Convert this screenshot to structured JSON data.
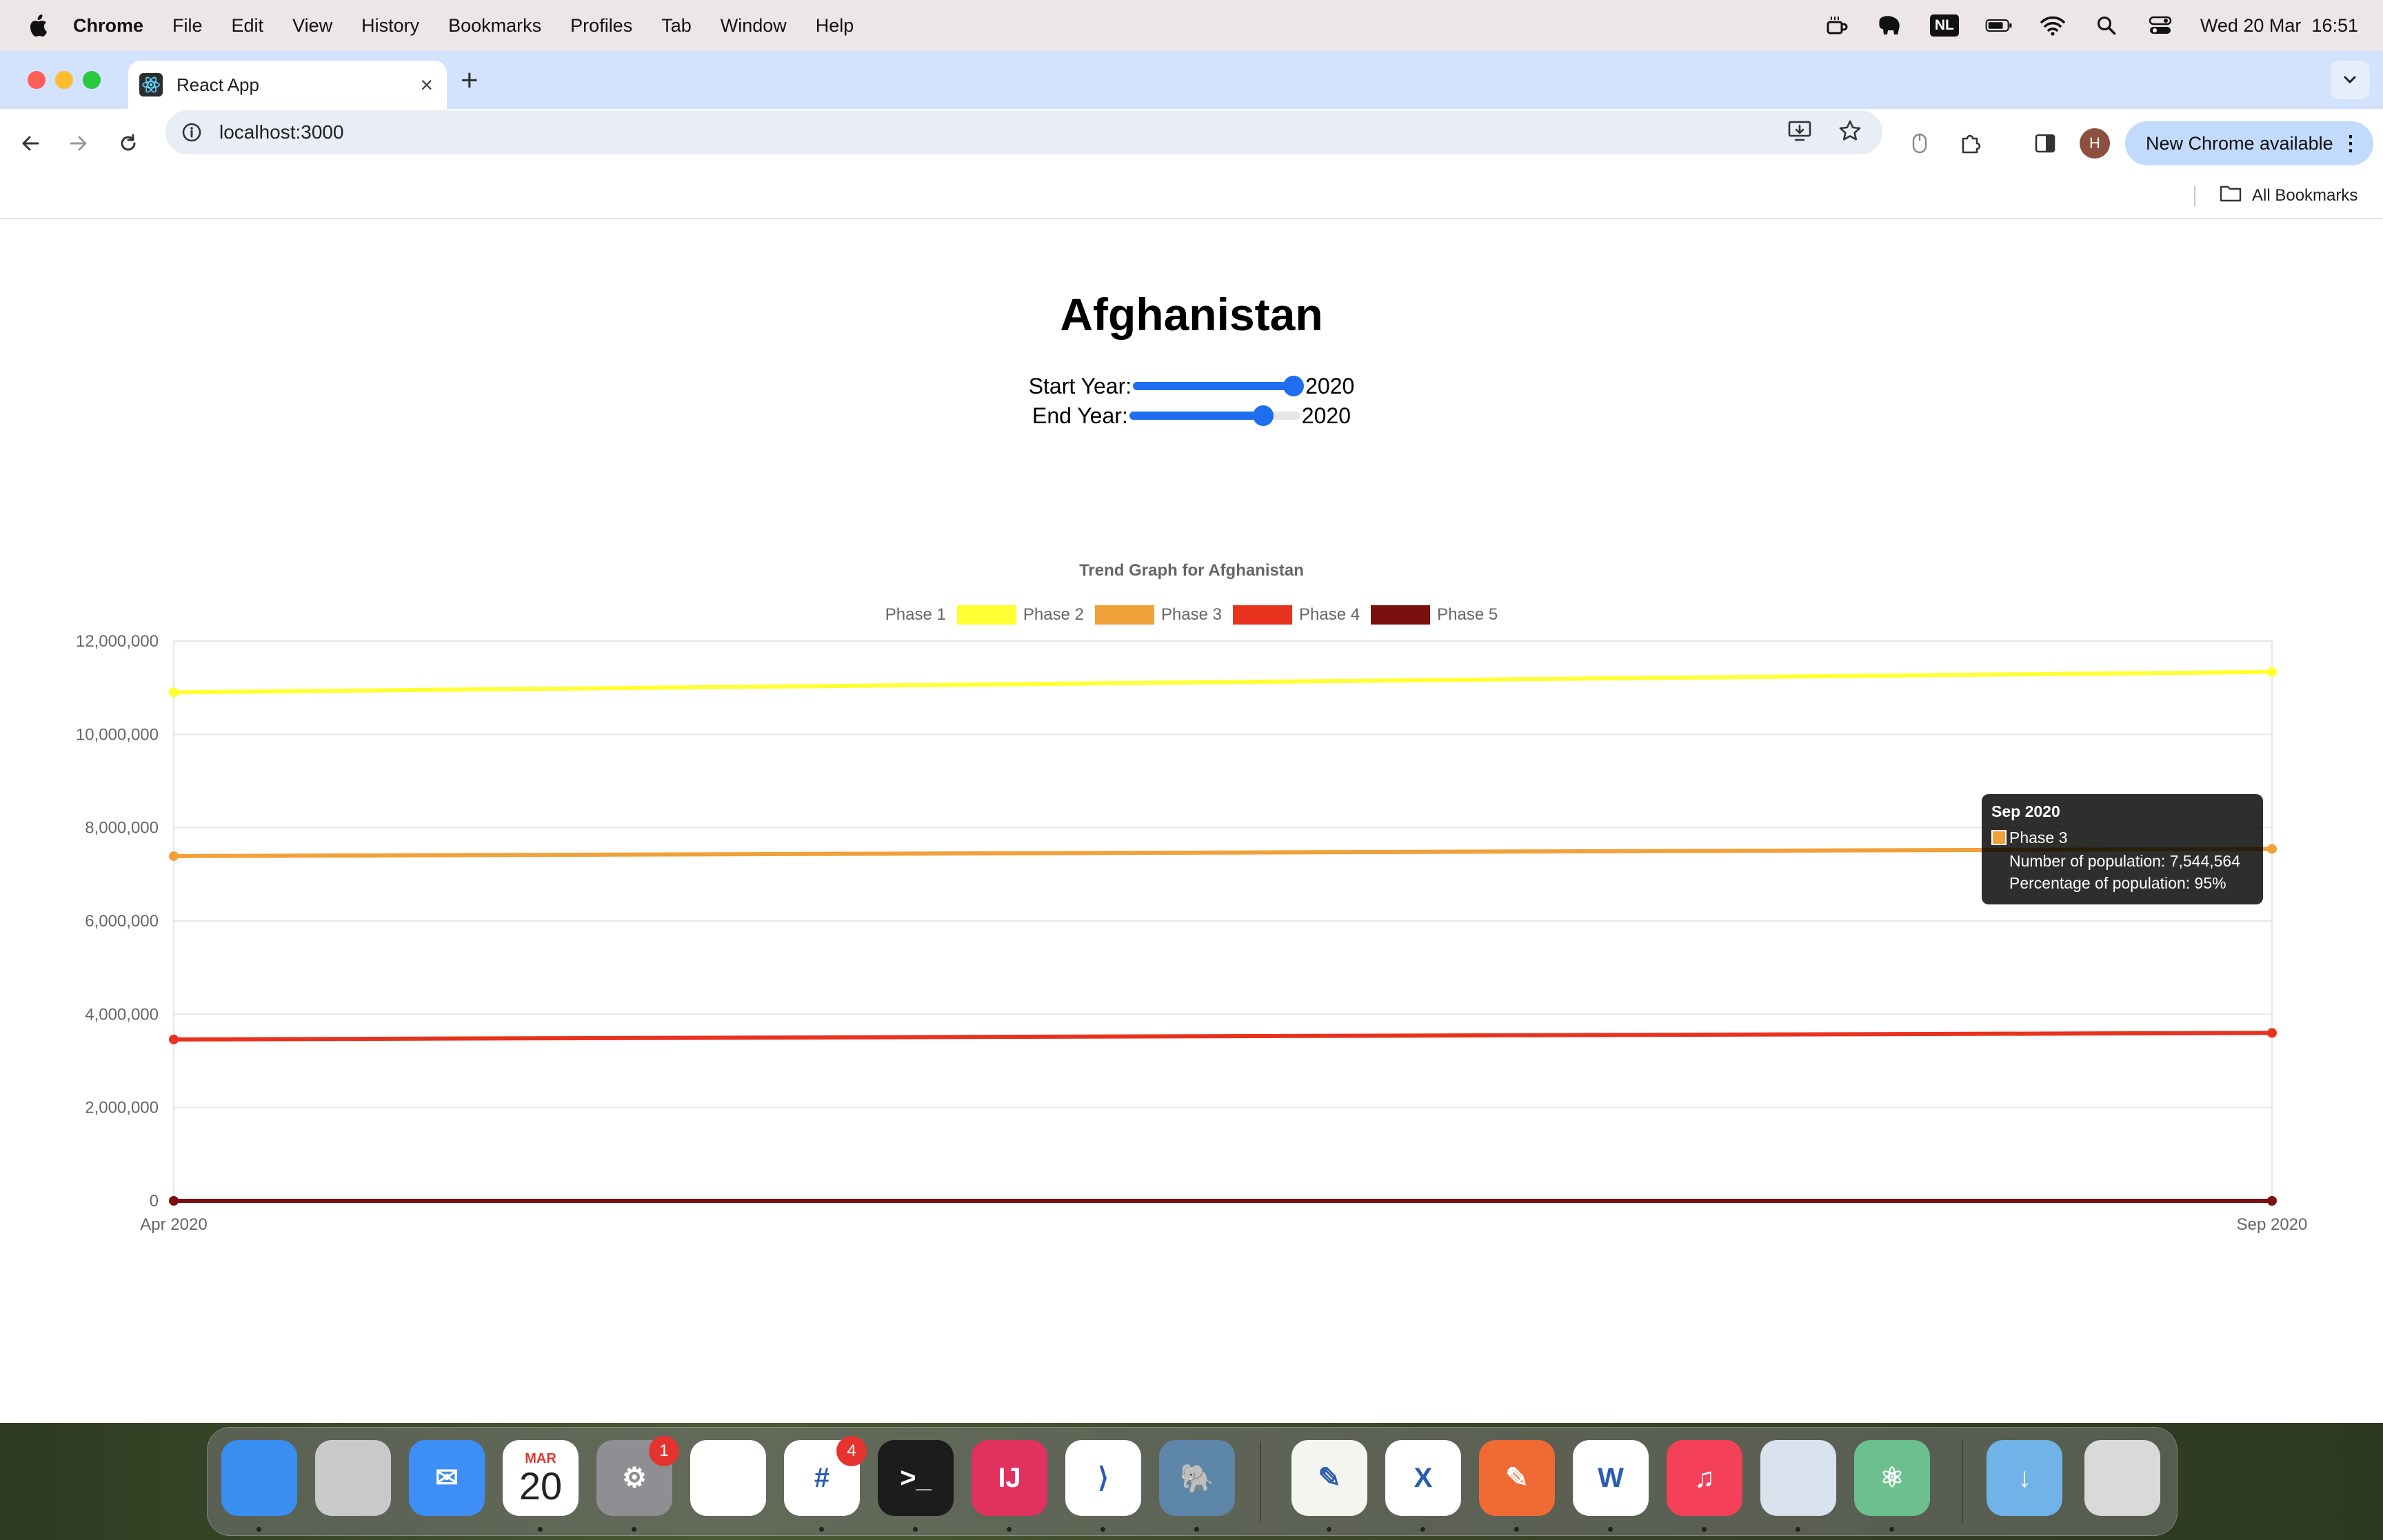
{
  "menubar": {
    "app_name": "Chrome",
    "items": [
      "File",
      "Edit",
      "View",
      "History",
      "Bookmarks",
      "Profiles",
      "Tab",
      "Window",
      "Help"
    ],
    "keyboard_layout": "NL",
    "datetime": "Wed 20 Mar  16:51"
  },
  "browser": {
    "tab_title": "React App",
    "url": "localhost:3000",
    "profile_initial": "H",
    "update_button": "New Chrome available",
    "bookmarks_label": "All Bookmarks"
  },
  "page": {
    "country": "Afghanistan",
    "start_year_label": "Start Year:",
    "start_year_value": "2020",
    "start_year_slider_fraction": 1.0,
    "end_year_label": "End Year:",
    "end_year_value": "2020",
    "end_year_slider_fraction": 0.82
  },
  "chart_data": {
    "type": "line",
    "title": "Trend Graph for Afghanistan",
    "x": [
      "Apr 2020",
      "Sep 2020"
    ],
    "ylim": [
      0,
      12000000
    ],
    "yticks": [
      "12,000,000",
      "10,000,000",
      "8,000,000",
      "6,000,000",
      "4,000,000",
      "2,000,000",
      "0"
    ],
    "ytick_values": [
      12000000,
      10000000,
      8000000,
      6000000,
      4000000,
      2000000,
      0
    ],
    "grid": true,
    "legend_position": "top",
    "series": [
      {
        "name": "Phase 1",
        "color": "",
        "values": []
      },
      {
        "name": "Phase 2",
        "color": "#ffff33",
        "values": [
          10900000,
          11340000
        ]
      },
      {
        "name": "Phase 3",
        "color": "#f0a13a",
        "values": [
          7390000,
          7544564
        ]
      },
      {
        "name": "Phase 4",
        "color": "#e8321e",
        "values": [
          3460000,
          3600000
        ]
      },
      {
        "name": "Phase 5",
        "color": "#7a1010",
        "values": [
          0,
          0
        ]
      }
    ]
  },
  "tooltip": {
    "title": "Sep 2020",
    "series": "Phase 3",
    "line1": "Number of population: 7,544,564",
    "line2": "Percentage of population: 95%",
    "color": "#f0a13a"
  },
  "dock": {
    "apps": [
      {
        "name": "Finder",
        "color": "#3a8ef0",
        "glyph": ""
      },
      {
        "name": "Launchpad",
        "color": "#c9c9c9",
        "glyph": ""
      },
      {
        "name": "Mail",
        "color": "#3d8ef5",
        "glyph": "✉"
      },
      {
        "name": "Calendar",
        "color": "#ffffff",
        "glyph": "20",
        "month": "MAR"
      },
      {
        "name": "System Settings",
        "color": "#8e8e93",
        "glyph": "⚙",
        "badge": "1"
      },
      {
        "name": "Chrome",
        "color": "#ffffff",
        "glyph": ""
      },
      {
        "name": "Slack",
        "color": "#ffffff",
        "glyph": "#",
        "badge": "4"
      },
      {
        "name": "Terminal",
        "color": "#1c1c1c",
        "glyph": ">_"
      },
      {
        "name": "IntelliJ IDEA",
        "color": "#e0315f",
        "glyph": "IJ"
      },
      {
        "name": "VS Code",
        "color": "#ffffff",
        "glyph": "⟩"
      },
      {
        "name": "pgAdmin",
        "color": "#5d86a9",
        "glyph": "🐘"
      },
      {
        "name": "TextEdit",
        "color": "#f5f5f0",
        "glyph": "✎"
      },
      {
        "name": "Excel",
        "color": "#ffffff",
        "glyph": "X"
      },
      {
        "name": "Postman",
        "color": "#f06b34",
        "glyph": "✎"
      },
      {
        "name": "Word",
        "color": "#ffffff",
        "glyph": "W"
      },
      {
        "name": "Music",
        "color": "#f5405a",
        "glyph": "♫"
      },
      {
        "name": "Preview",
        "color": "#d9e3ee",
        "glyph": ""
      },
      {
        "name": "Atom",
        "color": "#6bc08e",
        "glyph": "⚛"
      },
      {
        "name": "Downloads",
        "color": "#6fb3e8",
        "glyph": "↓"
      },
      {
        "name": "Trash",
        "color": "#d9d9d9",
        "glyph": ""
      }
    ]
  }
}
